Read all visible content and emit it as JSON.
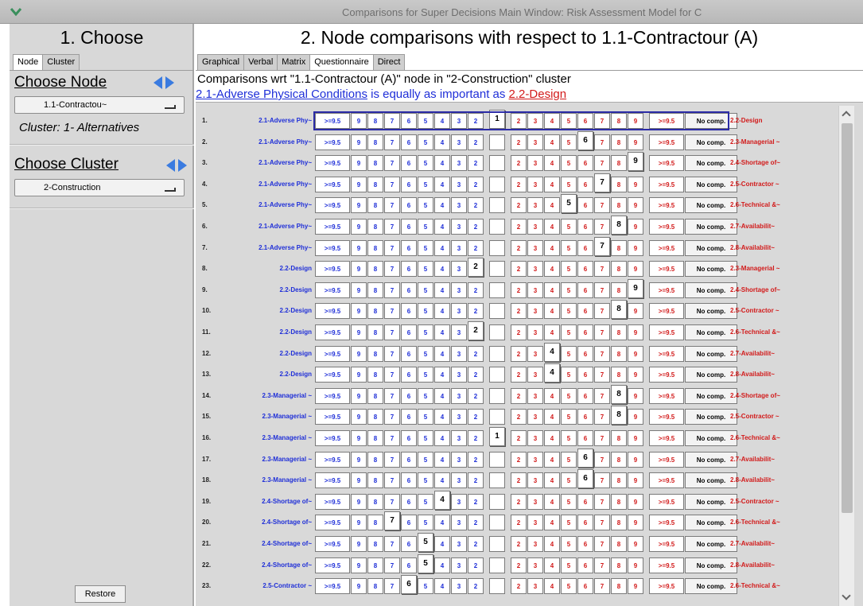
{
  "window": {
    "title": "Comparisons for Super Decisions Main Window: Risk Assessment Model for C"
  },
  "left": {
    "heading": "1. Choose",
    "tabs": [
      "Node",
      "Cluster"
    ],
    "choose_node_label": "Choose Node",
    "node_dropdown": "1.1-Contractou~",
    "cluster_caption": "Cluster: 1- Alternatives",
    "choose_cluster_label": "Choose Cluster",
    "cluster_dropdown": "2-Construction",
    "restore_label": "Restore"
  },
  "right": {
    "heading": "2. Node comparisons with respect to 1.1-Contractour (A)",
    "tabs": [
      "Graphical",
      "Verbal",
      "Matrix",
      "Questionnaire",
      "Direct"
    ],
    "active_tab": "Questionnaire",
    "info_line1": "Comparisons wrt \"1.1-Contractour (A)\" node in \"2-Construction\" cluster",
    "info_line2": {
      "left_node": "2.1-Adverse Physical Conditions",
      "middle": " is equally as important as ",
      "right_node": "2.2-Design"
    }
  },
  "scale": {
    "left": [
      ">=9.5",
      "9",
      "8",
      "7",
      "6",
      "5",
      "4",
      "3",
      "2"
    ],
    "center": "1",
    "right": [
      "2",
      "3",
      "4",
      "5",
      "6",
      "7",
      "8",
      "9",
      ">=9.5"
    ],
    "no_comp": "No comp."
  },
  "rows": [
    {
      "n": "1.",
      "left": "2.1-Adverse Phy~",
      "right": "2.2-Design",
      "sel": "center",
      "active": true
    },
    {
      "n": "2.",
      "left": "2.1-Adverse Phy~",
      "right": "2.3-Managerial ~",
      "sel": "r6"
    },
    {
      "n": "3.",
      "left": "2.1-Adverse Phy~",
      "right": "2.4-Shortage of~",
      "sel": "r9"
    },
    {
      "n": "4.",
      "left": "2.1-Adverse Phy~",
      "right": "2.5-Contractor ~",
      "sel": "r7"
    },
    {
      "n": "5.",
      "left": "2.1-Adverse Phy~",
      "right": "2.6-Technical &~",
      "sel": "r5"
    },
    {
      "n": "6.",
      "left": "2.1-Adverse Phy~",
      "right": "2.7-Availabilit~",
      "sel": "r8"
    },
    {
      "n": "7.",
      "left": "2.1-Adverse Phy~",
      "right": "2.8-Availabilit~",
      "sel": "r7"
    },
    {
      "n": "8.",
      "left": "2.2-Design",
      "right": "2.3-Managerial ~",
      "sel": "l2"
    },
    {
      "n": "9.",
      "left": "2.2-Design",
      "right": "2.4-Shortage of~",
      "sel": "r9"
    },
    {
      "n": "10.",
      "left": "2.2-Design",
      "right": "2.5-Contractor ~",
      "sel": "r8"
    },
    {
      "n": "11.",
      "left": "2.2-Design",
      "right": "2.6-Technical &~",
      "sel": "l2"
    },
    {
      "n": "12.",
      "left": "2.2-Design",
      "right": "2.7-Availabilit~",
      "sel": "r4"
    },
    {
      "n": "13.",
      "left": "2.2-Design",
      "right": "2.8-Availabilit~",
      "sel": "r4"
    },
    {
      "n": "14.",
      "left": "2.3-Managerial ~",
      "right": "2.4-Shortage of~",
      "sel": "r8"
    },
    {
      "n": "15.",
      "left": "2.3-Managerial ~",
      "right": "2.5-Contractor ~",
      "sel": "r8"
    },
    {
      "n": "16.",
      "left": "2.3-Managerial ~",
      "right": "2.6-Technical &~",
      "sel": "center"
    },
    {
      "n": "17.",
      "left": "2.3-Managerial ~",
      "right": "2.7-Availabilit~",
      "sel": "r6"
    },
    {
      "n": "18.",
      "left": "2.3-Managerial ~",
      "right": "2.8-Availabilit~",
      "sel": "r6"
    },
    {
      "n": "19.",
      "left": "2.4-Shortage of~",
      "right": "2.5-Contractor ~",
      "sel": "l4"
    },
    {
      "n": "20.",
      "left": "2.4-Shortage of~",
      "right": "2.6-Technical &~",
      "sel": "l7"
    },
    {
      "n": "21.",
      "left": "2.4-Shortage of~",
      "right": "2.7-Availabilit~",
      "sel": "l5"
    },
    {
      "n": "22.",
      "left": "2.4-Shortage of~",
      "right": "2.8-Availabilit~",
      "sel": "l5"
    },
    {
      "n": "23.",
      "left": "2.5-Contractor ~",
      "right": "2.6-Technical &~",
      "sel": "l6"
    }
  ],
  "colors": {
    "left_node": "#1f2fd8",
    "right_node": "#d21a1a",
    "arrow": "#3a7be0"
  }
}
